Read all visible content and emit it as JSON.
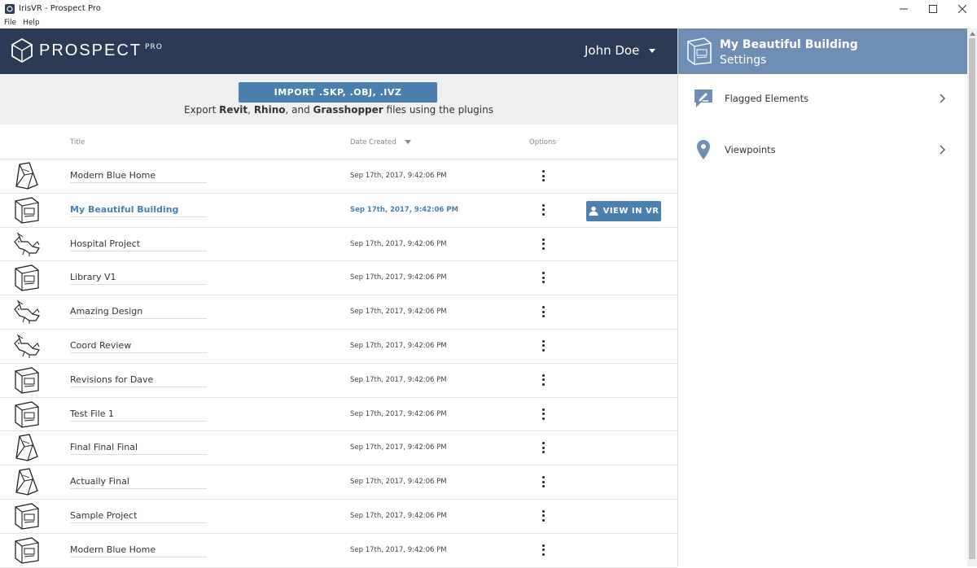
{
  "window": {
    "title": "IrisVR - Prospect Pro"
  },
  "menu": {
    "items": [
      "File",
      "Help"
    ]
  },
  "header": {
    "logo_word": "PROSPECT",
    "logo_tier": "PRO",
    "user_name": "John Doe"
  },
  "import": {
    "button_label": "IMPORT .SKP, .OBJ, .IVZ",
    "export_prefix": "Export ",
    "revit": "Revit",
    "sep1": ", ",
    "rhino": "Rhino",
    "sep2": ", and ",
    "grasshopper": "Grasshopper",
    "export_suffix": " files using the plugins"
  },
  "table": {
    "headers": {
      "title": "Title",
      "date": "Date Created",
      "options": "Options"
    },
    "view_vr_label": "VIEW IN VR",
    "rows": [
      {
        "title": "Modern Blue Home",
        "date": "Sep 17th, 2017, 9:42:06 PM",
        "icon": "revit-icon"
      },
      {
        "title": "My Beautiful Building",
        "date": "Sep 17th, 2017, 9:42:06 PM",
        "icon": "sketchup-icon",
        "active": true
      },
      {
        "title": "Hospital Project",
        "date": "Sep 17th, 2017, 9:42:06 PM",
        "icon": "rhino-icon"
      },
      {
        "title": "Library V1",
        "date": "Sep 17th, 2017, 9:42:06 PM",
        "icon": "sketchup-icon"
      },
      {
        "title": "Amazing Design",
        "date": "Sep 17th, 2017, 9:42:06 PM",
        "icon": "rhino-icon"
      },
      {
        "title": "Coord Review",
        "date": "Sep 17th, 2017, 9:42:06 PM",
        "icon": "rhino-icon"
      },
      {
        "title": "Revisions for Dave",
        "date": "Sep 17th, 2017, 9:42:06 PM",
        "icon": "sketchup-icon"
      },
      {
        "title": "Test File 1",
        "date": "Sep 17th, 2017, 9:42:06 PM",
        "icon": "sketchup-icon"
      },
      {
        "title": "Final Final Final",
        "date": "Sep 17th, 2017, 9:42:06 PM",
        "icon": "revit-icon"
      },
      {
        "title": "Actually Final",
        "date": "Sep 17th, 2017, 9:42:06 PM",
        "icon": "revit-icon"
      },
      {
        "title": "Sample Project",
        "date": "Sep 17th, 2017, 9:42:06 PM",
        "icon": "sketchup-icon"
      },
      {
        "title": "Modern Blue Home",
        "date": "Sep 17th, 2017, 9:42:06 PM",
        "icon": "sketchup-icon"
      }
    ]
  },
  "panel": {
    "title": "My Beautiful Building",
    "subtitle": "Settings",
    "items": [
      {
        "label": "Flagged Elements",
        "icon": "flag-edit-icon"
      },
      {
        "label": "Viewpoints",
        "icon": "map-pin-icon"
      }
    ]
  },
  "colors": {
    "header_bg": "#2b3a55",
    "accent": "#4a7fae",
    "panel_header": "#6f8eb5"
  }
}
